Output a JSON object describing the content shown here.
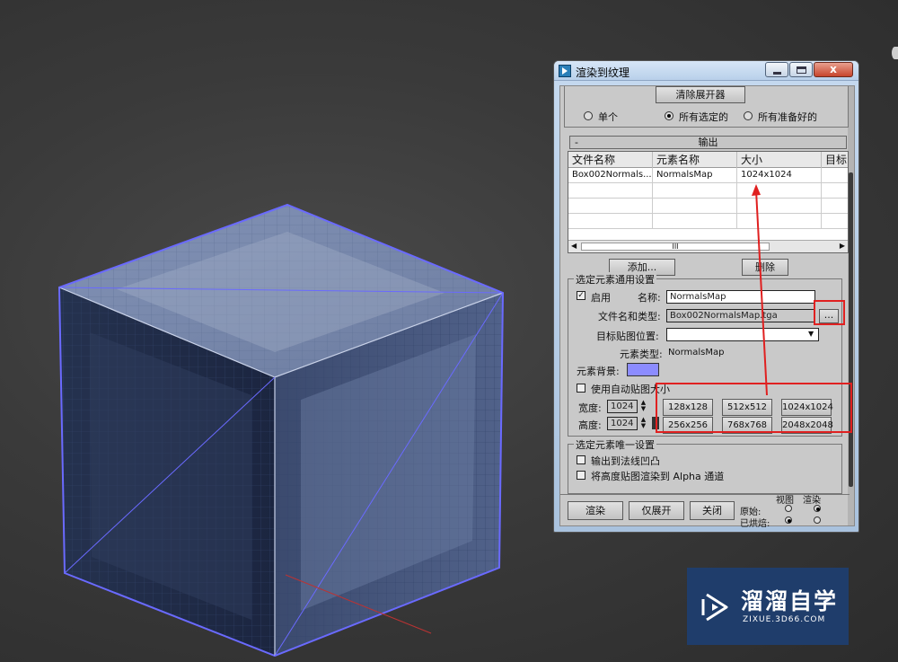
{
  "window": {
    "title": "渲染到纹理",
    "buttons": [
      "minimize",
      "maximize",
      "close"
    ]
  },
  "top_section": {
    "clear_button": "清除展开器",
    "radios": [
      {
        "label": "单个",
        "selected": false
      },
      {
        "label": "所有选定的",
        "selected": true
      },
      {
        "label": "所有准备好的",
        "selected": false
      }
    ]
  },
  "output": {
    "rollout_minus": "-",
    "rollout_title": "输出",
    "columns": [
      "文件名称",
      "元素名称",
      "大小",
      "目标"
    ],
    "rows": [
      [
        "Box002Normals...",
        "NormalsMap",
        "1024x1024",
        ""
      ]
    ],
    "scroll_grip": "III",
    "add_button": "添加...",
    "delete_button": "删除"
  },
  "common_settings": {
    "group_title": "选定元素通用设置",
    "enable_label": "启用",
    "enable_checked": true,
    "name_label": "名称:",
    "name_value": "NormalsMap",
    "filename_label": "文件名和类型:",
    "filename_value": "Box002NormalsMap.tga",
    "browse_button": "...",
    "target_label": "目标贴图位置:",
    "target_value": "",
    "element_type_label": "元素类型:",
    "element_type_value": "NormalsMap",
    "bg_label": "元素背景:",
    "bg_color": "#8c8cff",
    "auto_size_label": "使用自动贴图大小",
    "auto_size_checked": false,
    "width_label": "宽度:",
    "width_value": "1024",
    "height_label": "高度:",
    "height_value": "1024",
    "size_buttons": [
      "128x128",
      "512x512",
      "1024x1024",
      "256x256",
      "768x768",
      "2048x2048"
    ]
  },
  "unique_settings": {
    "group_title": "选定元素唯一设置",
    "option1": "输出到法线凹凸",
    "option2": "将高度贴图渲染到 Alpha 通道"
  },
  "footer": {
    "render_button": "渲染",
    "unwrap_button": "仅展开",
    "close_button": "关闭",
    "col_view": "视图",
    "col_render": "渲染",
    "row_original": "原始:",
    "row_baked": "已烘焙:"
  },
  "watermark": {
    "title": "溜溜自学",
    "url": "ZIXUE.3D66.COM"
  },
  "colors": {
    "annotation_red": "#e02020",
    "cube_wire": "#6a6aff",
    "watermark_bg": "#1f3d6b"
  }
}
